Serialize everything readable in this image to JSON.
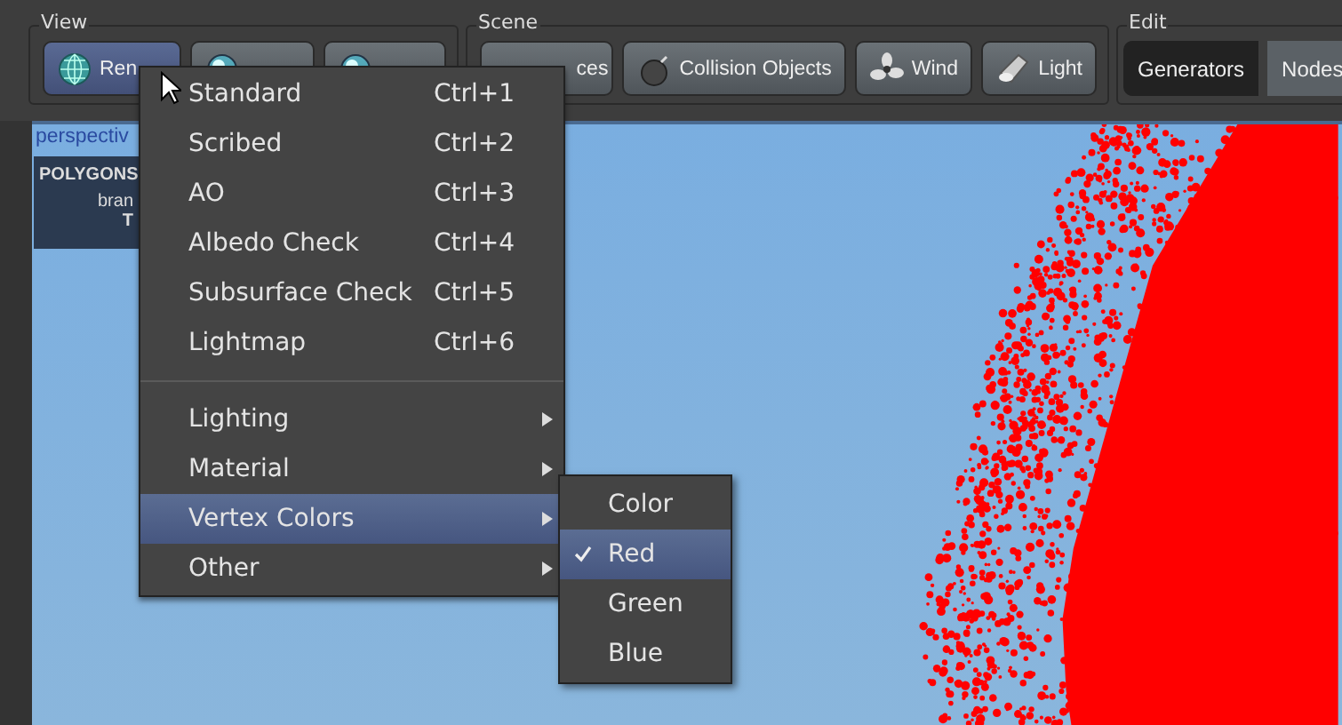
{
  "toolbar": {
    "groups": [
      {
        "title": "View",
        "buttons": [
          {
            "label": "Ren",
            "selected": true
          },
          {
            "selected": false
          },
          {
            "selected": false
          }
        ]
      },
      {
        "title": "Scene",
        "buttons": [
          {
            "label": "ces",
            "selected": false
          },
          {
            "label": "Collision Objects",
            "selected": false
          },
          {
            "label": "Wind",
            "selected": false
          },
          {
            "label": "Light",
            "selected": false
          }
        ]
      },
      {
        "title": "Edit",
        "tabs": [
          {
            "label": "Generators",
            "selected": true
          },
          {
            "label": "Nodes",
            "selected": false
          }
        ]
      }
    ]
  },
  "viewport": {
    "label": "perspectiv",
    "info": [
      {
        "text": "POLYGONS",
        "kind": "heading"
      },
      {
        "text": "bran",
        "kind": "label"
      },
      {
        "text": "T",
        "kind": "value"
      }
    ]
  },
  "menu": {
    "items": [
      {
        "kind": "command",
        "label": "Standard",
        "shortcut": "Ctrl+1",
        "selected": false
      },
      {
        "kind": "command",
        "label": "Scribed",
        "shortcut": "Ctrl+2",
        "selected": false
      },
      {
        "kind": "command",
        "label": "AO",
        "shortcut": "Ctrl+3",
        "selected": false
      },
      {
        "kind": "command",
        "label": "Albedo Check",
        "shortcut": "Ctrl+4",
        "selected": false
      },
      {
        "kind": "command",
        "label": "Subsurface Check",
        "shortcut": "Ctrl+5",
        "selected": false
      },
      {
        "kind": "command",
        "label": "Lightmap",
        "shortcut": "Ctrl+6",
        "selected": false
      },
      {
        "kind": "separator"
      },
      {
        "kind": "submenu",
        "label": "Lighting",
        "selected": false
      },
      {
        "kind": "submenu",
        "label": "Material",
        "selected": false
      },
      {
        "kind": "submenu",
        "label": "Vertex Colors",
        "selected": true
      },
      {
        "kind": "submenu",
        "label": "Other",
        "selected": false
      }
    ]
  },
  "submenu": {
    "items": [
      {
        "label": "Color",
        "checked": false,
        "selected": false
      },
      {
        "label": "Red",
        "checked": true,
        "selected": true
      },
      {
        "label": "Green",
        "checked": false,
        "selected": false
      },
      {
        "label": "Blue",
        "checked": false,
        "selected": false
      }
    ]
  }
}
